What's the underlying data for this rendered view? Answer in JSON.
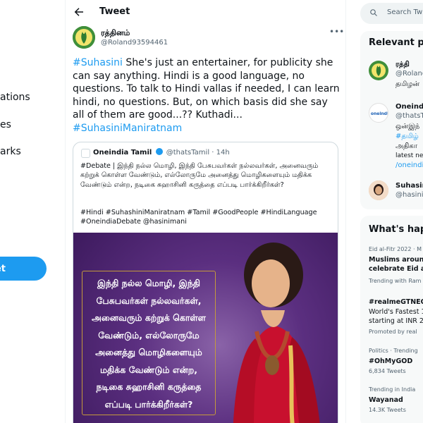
{
  "nav": {
    "items": [
      "ations",
      "es",
      "arks"
    ],
    "tweet_button": "et"
  },
  "header": {
    "title": "Tweet"
  },
  "tweet": {
    "author_name": "ரத்தினம்",
    "author_handle": "@Roland93594461",
    "text_parts": [
      "#Suhasini",
      " She's just an entertainer,  for publicity she can say anything. Hindi is a good language, no questions. To talk to Hindi vallas if needed, I can learn hindi, no questions. But, on which basis did she say all of them are good...?? Kuthadi...",
      "#SuhasiniManiratnam"
    ]
  },
  "quote": {
    "name": "Oneindia Tamil",
    "handle": "@thatsTamil",
    "time": "· 14h",
    "body": "#Debate | இந்தி நல்ல மொழி, இந்தி பேசுபவர்கள் நல்லவர்கள், அனைவரும் கற்றுக் கொள்ள வேண்டும், எல்லோருமே அனைத்து மொழிகளையும் மதிக்க வேண்டும் என்ற, நடிகை சுஹாசினி கருத்தை எப்படி பார்க்கிறீர்கள்?",
    "tags": "#Hindi #SuhashiniManiratnam #Tamil #GoodPeople #HindiLanguage #OneindiaDebate @hasinimani",
    "poster_lines": [
      "இந்தி நல்ல மொழி, இந்தி",
      "பேசுபவர்கள் நல்லவர்கள்,",
      "அனைவரும் கற்றுக் கொள்ள",
      "வேண்டும், எல்லோருமே",
      "அனைத்து மொழிகளையும்",
      "மதிக்க வேண்டும் என்ற,",
      "நடிகை சுஹாசினி கருத்தை",
      "எப்படி பார்க்கிறீர்கள்?"
    ]
  },
  "sidebar": {
    "search_placeholder": "Search Twi",
    "relevant": {
      "title": "Relevant pe",
      "people": [
        {
          "name": "ரத்தி",
          "handle": "@Roland",
          "desc": "தமிழன்"
        },
        {
          "name": "Oneindi",
          "handle": "@thatsT",
          "lines": [
            "ஒன்இந்",
            "#தமிழ்",
            "அதிகா",
            "latest ne",
            "/oneindi"
          ]
        },
        {
          "name": "Suhasin",
          "handle": "@hasini"
        }
      ]
    },
    "happening": {
      "title": "What's happ",
      "trends": [
        {
          "meta": "Eid al-Fitr 2022 · M",
          "bold": [
            "Muslims around",
            "celebrate Eid al-"
          ],
          "extra": "Trending with Ram F"
        },
        {
          "meta": "",
          "bold": [
            "#realmeGTNEO3"
          ],
          "lines": [
            "World's Fastest 1",
            "starting at INR 29"
          ],
          "extra": "Promoted by real"
        },
        {
          "meta": "Politics · Trending",
          "bold": [
            "#OhMyGOD"
          ],
          "extra": "6,834 Tweets"
        },
        {
          "meta": "Trending in India",
          "bold": [
            "Wayanad"
          ],
          "extra": "14.3K Tweets"
        }
      ]
    }
  },
  "colors": {
    "accent": "#1d9bf0",
    "poster_bg": "#5b2f80",
    "saree_red": "#c8102e"
  }
}
